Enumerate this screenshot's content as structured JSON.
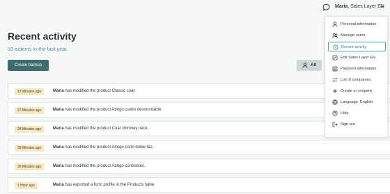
{
  "header": {
    "user_name": "Maria",
    "user_context": ", Sales Layer EN"
  },
  "page": {
    "title": "Recent activity",
    "subtitle": "33 actions in the last year",
    "backup_label": "Create backup",
    "filter_label": "All"
  },
  "activity": [
    {
      "time": "17 Minutes ago",
      "user": "Maria",
      "text": " has modified the product Classic coat."
    },
    {
      "time": "27 Minutes ago",
      "user": "Maria",
      "text": " has modified the product Abrigo cuello desmontable."
    },
    {
      "time": "28 Minutes ago",
      "user": "Maria",
      "text": " has modified the product Coat chimney neck."
    },
    {
      "time": "29 Minutes ago",
      "user": "Maria",
      "text": " has modified the product Abrigo corto doble faz."
    },
    {
      "time": "30 Minutes ago",
      "user": "Maria",
      "text": " has modified the product Abrigo contrastes."
    },
    {
      "time": "1 Hour ago",
      "user": "Maria",
      "text": " has exported a form profile in the Products table."
    }
  ],
  "menu": {
    "items": [
      {
        "label": "Personal information",
        "icon": "user-icon"
      },
      {
        "label": "Manage users",
        "icon": "users-icon"
      },
      {
        "label": "Recent activity",
        "icon": "clock-icon",
        "active": true
      },
      {
        "label": "Edit Sales Layer EN",
        "icon": "edit-icon"
      },
      {
        "label": "Payment information",
        "icon": "payment-icon"
      },
      {
        "label": "List of companies",
        "icon": "list-icon"
      },
      {
        "label": "Create a company",
        "icon": "plus-icon"
      },
      {
        "label": "Language: English",
        "icon": "globe-icon"
      },
      {
        "label": "Help",
        "icon": "help-icon"
      },
      {
        "label": "Sign-out",
        "icon": "signout-icon"
      }
    ]
  },
  "colors": {
    "accent": "#3d6d6e",
    "highlight": "#42a8c8",
    "badge": "#f8e8bf"
  }
}
